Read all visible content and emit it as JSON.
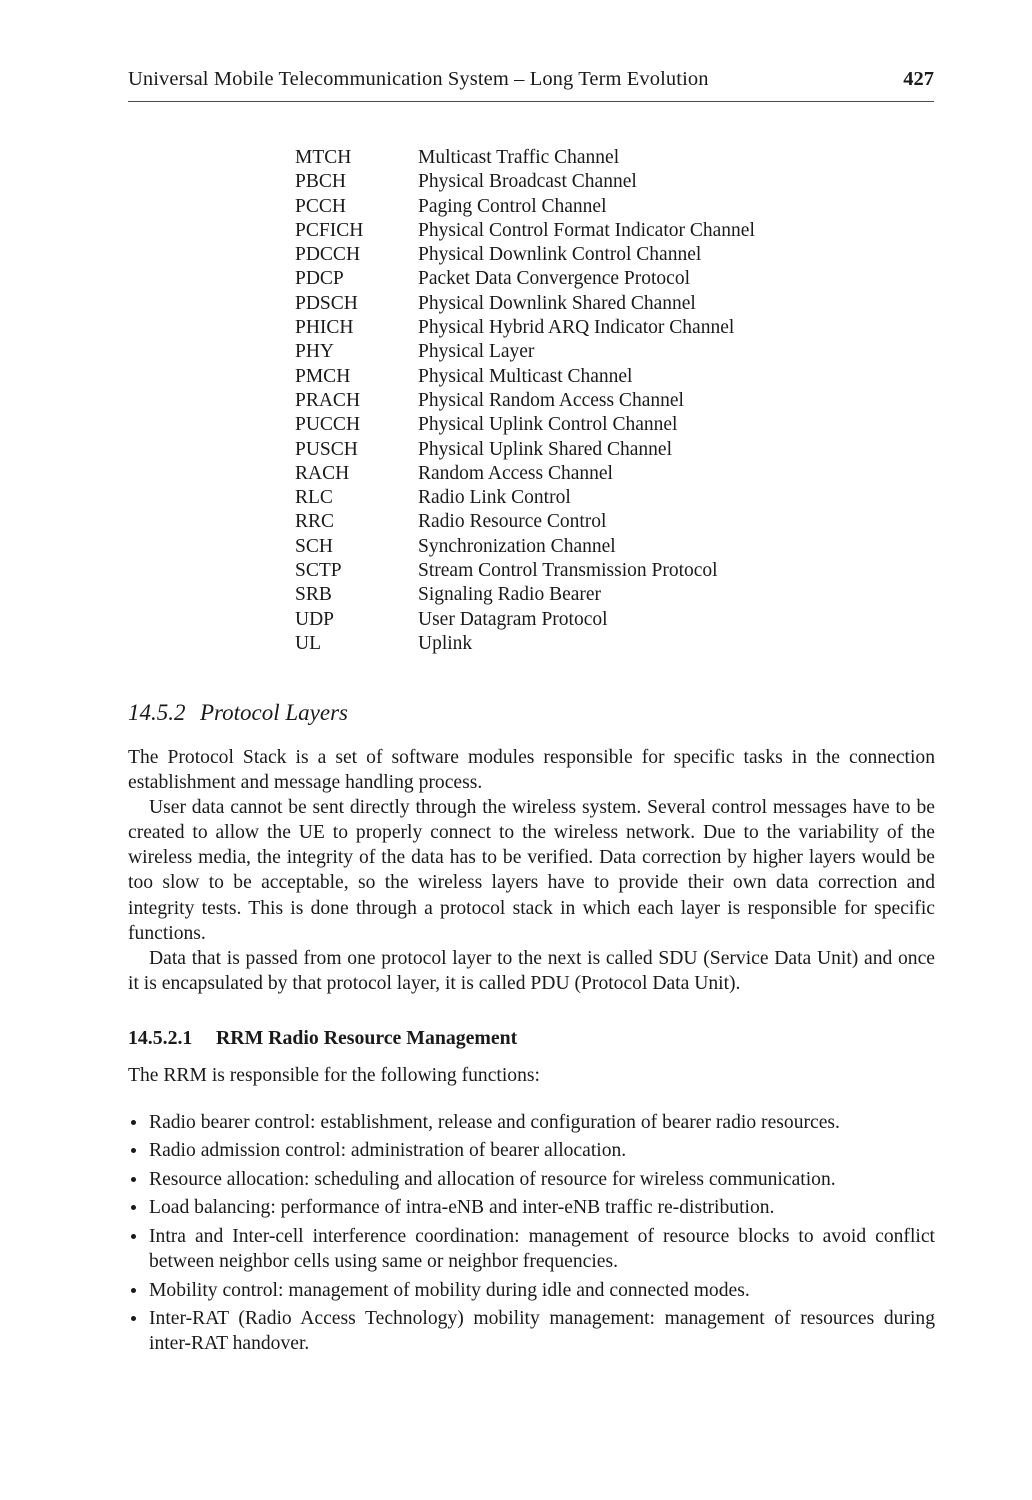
{
  "running_head": {
    "title": "Universal Mobile Telecommunication System – Long Term Evolution",
    "page_number": "427"
  },
  "abbreviations": [
    {
      "term": "MTCH",
      "definition": "Multicast Traffic Channel"
    },
    {
      "term": "PBCH",
      "definition": "Physical Broadcast Channel"
    },
    {
      "term": "PCCH",
      "definition": "Paging Control Channel"
    },
    {
      "term": "PCFICH",
      "definition": "Physical Control Format Indicator Channel"
    },
    {
      "term": "PDCCH",
      "definition": "Physical Downlink Control Channel"
    },
    {
      "term": "PDCP",
      "definition": "Packet Data Convergence Protocol"
    },
    {
      "term": "PDSCH",
      "definition": "Physical Downlink Shared Channel"
    },
    {
      "term": "PHICH",
      "definition": "Physical Hybrid ARQ Indicator Channel"
    },
    {
      "term": "PHY",
      "definition": "Physical Layer"
    },
    {
      "term": "PMCH",
      "definition": "Physical Multicast Channel"
    },
    {
      "term": "PRACH",
      "definition": "Physical Random Access Channel"
    },
    {
      "term": "PUCCH",
      "definition": "Physical Uplink Control Channel"
    },
    {
      "term": "PUSCH",
      "definition": "Physical Uplink Shared Channel"
    },
    {
      "term": "RACH",
      "definition": "Random Access Channel"
    },
    {
      "term": "RLC",
      "definition": "Radio Link Control"
    },
    {
      "term": "RRC",
      "definition": "Radio Resource Control"
    },
    {
      "term": "SCH",
      "definition": "Synchronization Channel"
    },
    {
      "term": "SCTP",
      "definition": "Stream Control Transmission Protocol"
    },
    {
      "term": "SRB",
      "definition": "Signaling Radio Bearer"
    },
    {
      "term": "UDP",
      "definition": "User Datagram Protocol"
    },
    {
      "term": "UL",
      "definition": "Uplink"
    }
  ],
  "section": {
    "number": "14.5.2",
    "title": "Protocol Layers",
    "paragraphs": [
      "The Protocol Stack is a set of software modules responsible for specific tasks in the connection establishment and message handling process.",
      "User data cannot be sent directly through the wireless system. Several control messages have to be created to allow the UE to properly connect to the wireless network. Due to the variability of the wireless media, the integrity of the data has to be verified. Data correction by higher layers would be too slow to be acceptable, so the wireless layers have to provide their own data correction and integrity tests. This is done through a protocol stack in which each layer is responsible for specific functions.",
      "Data that is passed from one protocol layer to the next is called SDU (Service Data Unit) and once it is encapsulated by that protocol layer, it is called PDU (Protocol Data Unit)."
    ]
  },
  "subsection": {
    "number": "14.5.2.1",
    "title": "RRM Radio Resource Management",
    "intro": "The RRM is responsible for the following functions:",
    "bullets": [
      "Radio bearer control: establishment, release and configuration of bearer radio resources.",
      "Radio admission control: administration of bearer allocation.",
      "Resource allocation: scheduling and allocation of resource for wireless communication.",
      "Load balancing: performance of intra-eNB and inter-eNB traffic re-distribution.",
      "Intra and Inter-cell interference coordination: management of resource blocks to avoid conflict between neighbor cells using same or neighbor frequencies.",
      "Mobility control: management of mobility during idle and connected modes.",
      "Inter-RAT (Radio Access Technology) mobility management: management of resources during inter-RAT handover."
    ]
  }
}
